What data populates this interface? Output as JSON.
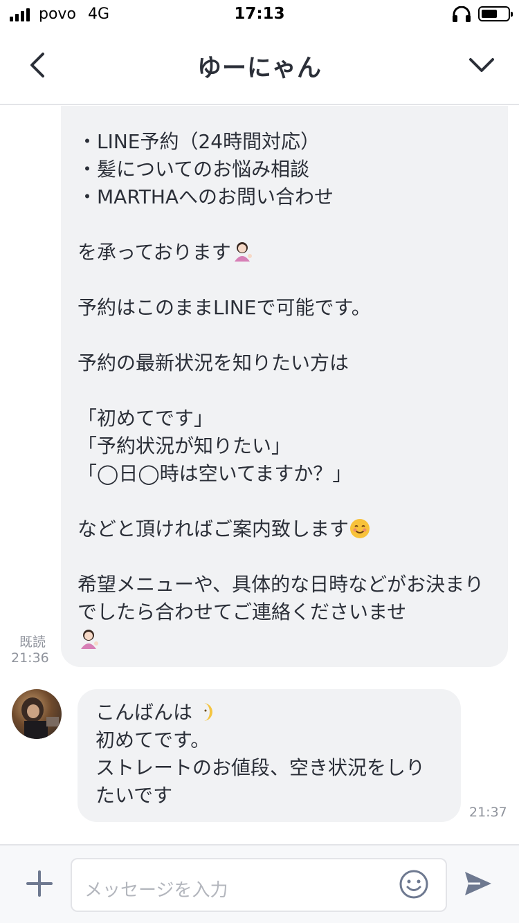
{
  "status_bar": {
    "carrier": "povo",
    "network": "4G",
    "time": "17:13",
    "icons": [
      "signal-icon",
      "headphones-icon",
      "battery-icon"
    ]
  },
  "header": {
    "title": "ゆーにゃん",
    "icons": [
      "back-icon",
      "chevron-down-icon"
    ]
  },
  "messages": [
    {
      "direction": "outgoing",
      "text": "・LINE予約（24時間対応）\n・髪についてのお悩み相談\n・MARTHAへのお問い合わせ\n\nを承っております",
      "text_2": "\n\n予約はこのままLINEで可能です。\n\n予約の最新状況を知りたい方は\n\n「初めてです」\n「予約状況が知りたい」\n「◯日◯時は空いてますか？」\n\nなどと頂ければご案内致します",
      "text_3": "\n\n希望メニューや、具体的な日時などがお決まりでしたら合わせてご連絡くださいませ\n",
      "read_label": "既読",
      "time": "21:36"
    },
    {
      "direction": "incoming",
      "text": "こんばんは",
      "text_2": "\n初めてです。\nストレートのお値段、空き状況をしりたいです",
      "time": "21:37"
    }
  ],
  "input_bar": {
    "placeholder": "メッセージを入力",
    "icons": [
      "plus-icon",
      "smile-icon",
      "send-icon"
    ]
  },
  "colors": {
    "bubble": "#f1f2f4",
    "text": "#2b2f38",
    "meta": "#8f939c",
    "send": "#6e7990"
  }
}
